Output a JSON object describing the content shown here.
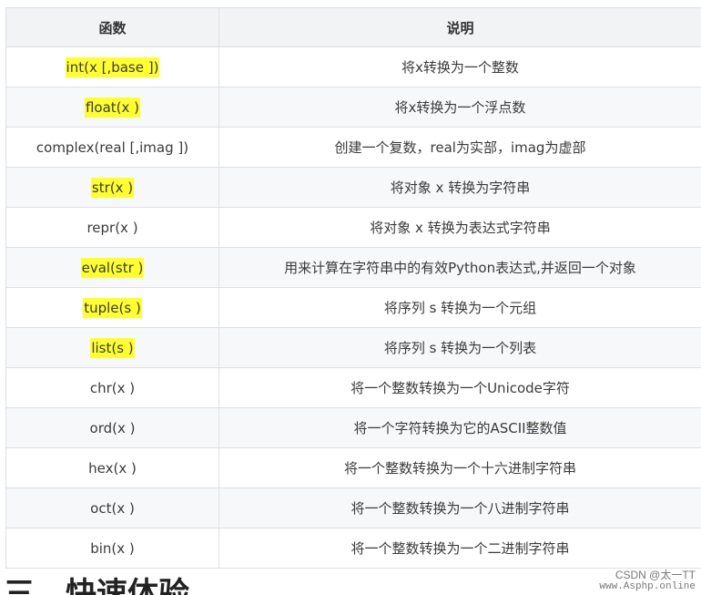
{
  "table": {
    "headers": [
      "函数",
      "说明"
    ],
    "rows": [
      {
        "function": "int(x [,base ])",
        "description": "将x转换为一个整数",
        "highlighted": true
      },
      {
        "function": "float(x )",
        "description": "将x转换为一个浮点数",
        "highlighted": true
      },
      {
        "function": "complex(real [,imag ])",
        "description": "创建一个复数，real为实部，imag为虚部",
        "highlighted": false
      },
      {
        "function": "str(x )",
        "description": "将对象 x 转换为字符串",
        "highlighted": true
      },
      {
        "function": "repr(x )",
        "description": "将对象 x 转换为表达式字符串",
        "highlighted": false
      },
      {
        "function": "eval(str )",
        "description": "用来计算在字符串中的有效Python表达式,并返回一个对象",
        "highlighted": true
      },
      {
        "function": "tuple(s )",
        "description": "将序列 s 转换为一个元组",
        "highlighted": true
      },
      {
        "function": "list(s )",
        "description": "将序列 s 转换为一个列表",
        "highlighted": true
      },
      {
        "function": "chr(x )",
        "description": "将一个整数转换为一个Unicode字符",
        "highlighted": false
      },
      {
        "function": "ord(x )",
        "description": "将一个字符转换为它的ASCII整数值",
        "highlighted": false
      },
      {
        "function": "hex(x )",
        "description": "将一个整数转换为一个十六进制字符串",
        "highlighted": false
      },
      {
        "function": "oct(x )",
        "description": "将一个整数转换为一个八进制字符串",
        "highlighted": false
      },
      {
        "function": "bin(x )",
        "description": "将一个整数转换为一个二进制字符串",
        "highlighted": false
      }
    ]
  },
  "footer": {
    "heading": "三、快速体验"
  },
  "watermark": {
    "line1": "CSDN @太一TT",
    "line2": "www.Asphp.online"
  },
  "colors": {
    "highlight": "#ffff2e",
    "header_bg": "#f1f3f5",
    "border": "#dde0e4",
    "stripe": "#f7f8fa"
  }
}
